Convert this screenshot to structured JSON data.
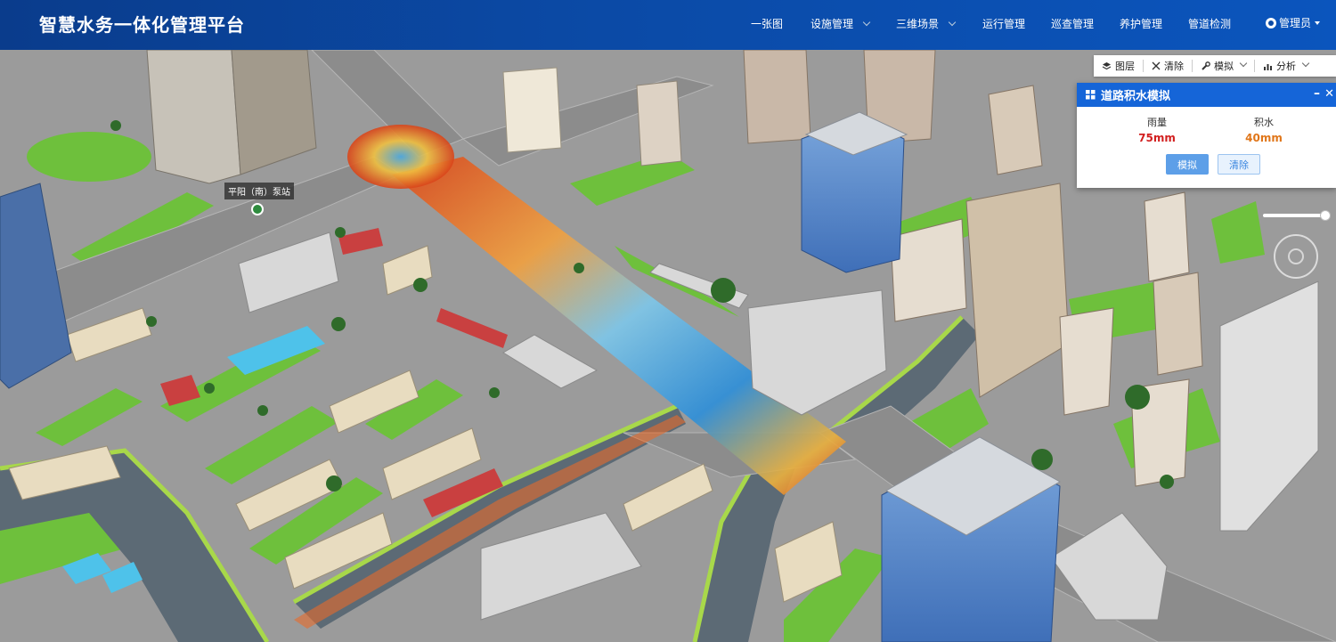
{
  "app": {
    "title": "智慧水务一体化管理平台"
  },
  "nav": [
    {
      "label": "一张图",
      "dropdown": false
    },
    {
      "label": "设施管理",
      "dropdown": true
    },
    {
      "label": "三维场景",
      "dropdown": true
    },
    {
      "label": "运行管理",
      "dropdown": false
    },
    {
      "label": "巡查管理",
      "dropdown": false
    },
    {
      "label": "养护管理",
      "dropdown": false
    },
    {
      "label": "管道检测",
      "dropdown": false
    }
  ],
  "user": {
    "label": "管理员"
  },
  "toolbar": {
    "layers_label": "图层",
    "clear_label": "清除",
    "simulate_label": "模拟",
    "analysis_label": "分析"
  },
  "panel": {
    "title": "道路积水模拟",
    "rain_label": "雨量",
    "rain_value": "75mm",
    "water_label": "积水",
    "water_value": "40mm",
    "simulate_button": "模拟",
    "clear_button": "清除"
  },
  "map": {
    "poi_label": "平阳（南）泵站",
    "slider_level": 1.0
  },
  "colors": {
    "header_bg": "#0b4aa6",
    "panel_head": "#1565d8",
    "rain_value": "#d21f1f",
    "water_value": "#e0761a",
    "road": "#8f8f8f",
    "grass": "#6cbf3a",
    "water": "#5e6e7a"
  }
}
